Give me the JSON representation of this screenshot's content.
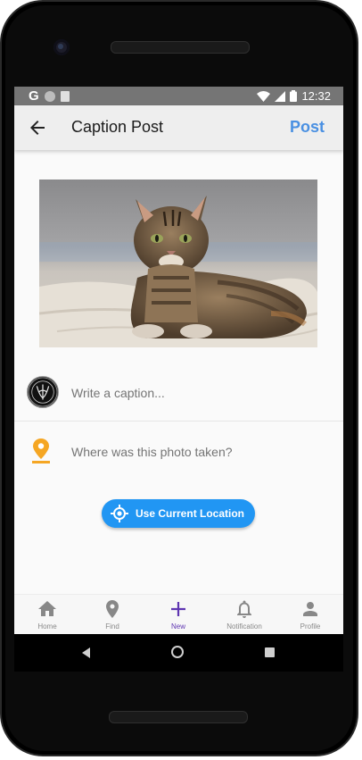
{
  "status_bar": {
    "time": "12:32",
    "carrier_glyph": "G"
  },
  "app_bar": {
    "title": "Caption Post",
    "back_icon": "arrow-left-icon",
    "post_label": "Post",
    "post_color": "#4a90e2"
  },
  "photo": {
    "subject": "tabby cat lying on a blanket"
  },
  "caption": {
    "placeholder": "Write a caption...",
    "value": ""
  },
  "location": {
    "placeholder": "Where was this photo taken?",
    "value": "",
    "icon": "location-pin-icon",
    "icon_color": "#f5a623"
  },
  "location_button": {
    "label": "Use Current Location",
    "icon": "gps-target-icon",
    "color": "#2196f3"
  },
  "bottom_nav": {
    "active_color": "#5e35b1",
    "items": [
      {
        "label": "Home",
        "icon": "home-icon"
      },
      {
        "label": "Find",
        "icon": "map-pin-icon"
      },
      {
        "label": "New",
        "icon": "plus-icon",
        "active": true
      },
      {
        "label": "Notification",
        "icon": "bell-icon"
      },
      {
        "label": "Profile",
        "icon": "person-icon"
      }
    ]
  }
}
